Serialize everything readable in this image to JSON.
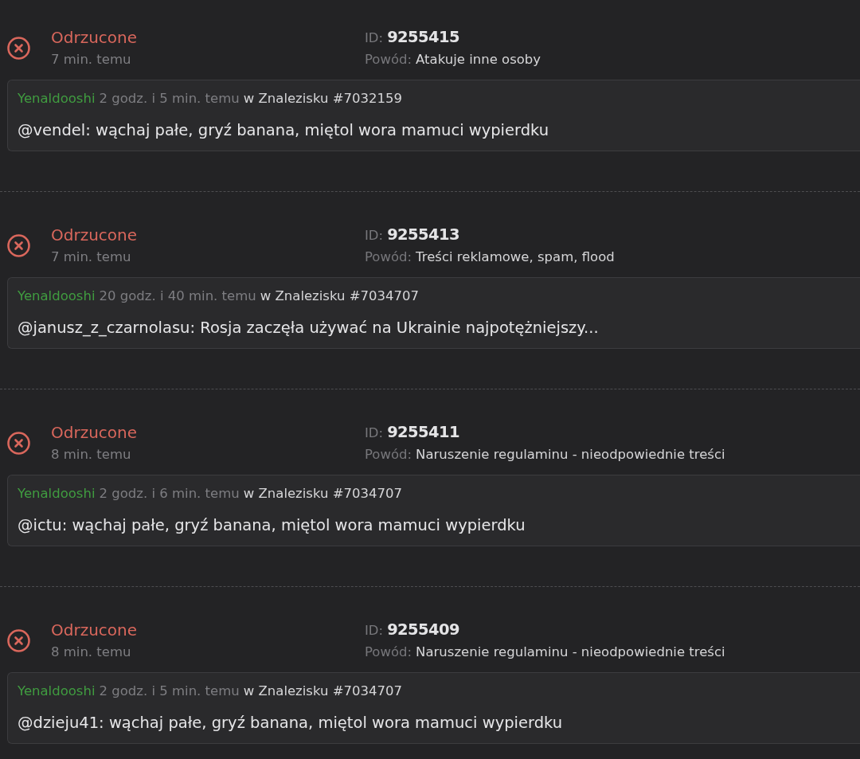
{
  "entries": [
    {
      "status": {
        "kind": "rejected",
        "label": "Odrzucone"
      },
      "time": "7 min. temu",
      "id_label": "ID:",
      "id": "9255415",
      "reason_label": "Powód:",
      "reason": "Atakuje inne osoby",
      "comment": {
        "author": "Yenaldooshi",
        "time": "2 godz. i 5 min. temu",
        "location": "w Znalezisku #7032159",
        "text": "@vendel: wąchaj pałe, gryź banana, miętol wora mamuci wypierdku"
      }
    },
    {
      "status": {
        "kind": "rejected",
        "label": "Odrzucone"
      },
      "time": "7 min. temu",
      "id_label": "ID:",
      "id": "9255413",
      "reason_label": "Powód:",
      "reason": "Treści reklamowe, spam, flood",
      "comment": {
        "author": "Yenaldooshi",
        "time": "20 godz. i 40 min. temu",
        "location": "w Znalezisku #7034707",
        "text": "@janusz_z_czarnolasu: Rosja zaczęła używać na Ukrainie najpotężniejszy..."
      }
    },
    {
      "status": {
        "kind": "rejected",
        "label": "Odrzucone"
      },
      "time": "8 min. temu",
      "id_label": "ID:",
      "id": "9255411",
      "reason_label": "Powód:",
      "reason": "Naruszenie regulaminu - nieodpowiednie treści",
      "comment": {
        "author": "Yenaldooshi",
        "time": "2 godz. i 6 min. temu",
        "location": "w Znalezisku #7034707",
        "text": "@ictu: wąchaj pałe, gryź banana, miętol wora mamuci wypierdku"
      }
    },
    {
      "status": {
        "kind": "rejected",
        "label": "Odrzucone"
      },
      "time": "8 min. temu",
      "id_label": "ID:",
      "id": "9255409",
      "reason_label": "Powód:",
      "reason": "Naruszenie regulaminu - nieodpowiednie treści",
      "comment": {
        "author": "Yenaldooshi",
        "time": "2 godz. i 5 min. temu",
        "location": "w Znalezisku #7034707",
        "text": "@dzieju41: wąchaj pałe, gryź banana, miętol wora mamuci wypierdku"
      }
    }
  ]
}
